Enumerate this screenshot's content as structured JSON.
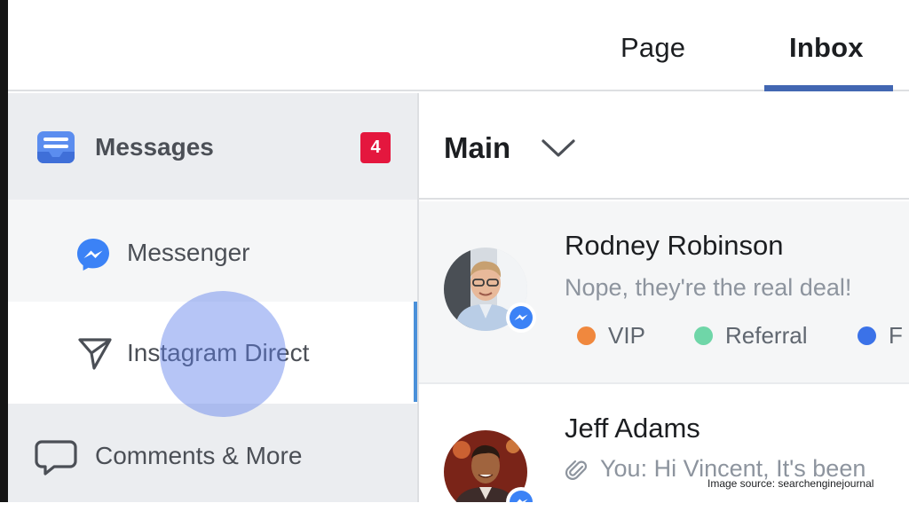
{
  "tabs": {
    "page": "Page",
    "inbox": "Inbox",
    "active": "Inbox"
  },
  "sidebar": {
    "messages": {
      "label": "Messages",
      "badge": "4",
      "icon": "inbox-icon"
    },
    "items": [
      {
        "label": "Messenger",
        "icon": "messenger-icon"
      },
      {
        "label": "Instagram Direct",
        "icon": "send-icon",
        "active": true
      },
      {
        "label": "Comments & More",
        "icon": "comment-icon"
      }
    ]
  },
  "main": {
    "title": "Main",
    "conversations": [
      {
        "name": "Rodney Robinson",
        "preview": "Nope, they're the real deal!",
        "tags": [
          {
            "label": "VIP",
            "color": "#f0883e"
          },
          {
            "label": "Referral",
            "color": "#6fd6a8"
          },
          {
            "label": "F",
            "color": "#3b72e8"
          }
        ]
      },
      {
        "name": "Jeff Adams",
        "preview": "You: Hi Vincent, It's been"
      }
    ]
  },
  "colors": {
    "accent": "#4267b2",
    "badge": "#e4173e",
    "messenger": "#3b82f6"
  },
  "source_note": "Image source: searchenginejournal"
}
